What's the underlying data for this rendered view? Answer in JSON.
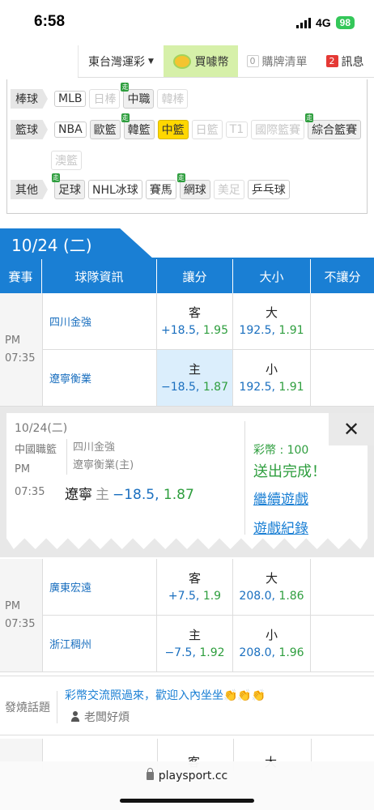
{
  "status_bar": {
    "time": "6:58",
    "network": "4G",
    "battery": "98"
  },
  "top_nav": {
    "lottery_label": "東台灣運彩",
    "buy_label": "買噱幣",
    "cart_count": "0",
    "cart_label": "購牌清單",
    "message_count": "2",
    "message_label": "訊息"
  },
  "filters": {
    "baseball": {
      "label": "棒球",
      "items": [
        {
          "label": "MLB",
          "state": "normal",
          "tag": ""
        },
        {
          "label": "日棒",
          "state": "off",
          "tag": ""
        },
        {
          "label": "中職",
          "state": "walk",
          "tag": "走"
        },
        {
          "label": "韓棒",
          "state": "off",
          "tag": ""
        }
      ]
    },
    "basketball": {
      "label": "籃球",
      "items": [
        {
          "label": "NBA",
          "state": "normal",
          "tag": ""
        },
        {
          "label": "歐籃",
          "state": "walk",
          "tag": ""
        },
        {
          "label": "韓籃",
          "state": "walk",
          "tag": "走"
        },
        {
          "label": "中籃",
          "state": "sel",
          "tag": ""
        },
        {
          "label": "日籃",
          "state": "off",
          "tag": ""
        },
        {
          "label": "T1",
          "state": "off",
          "tag": ""
        },
        {
          "label": "國際籃賽",
          "state": "off",
          "tag": ""
        },
        {
          "label": "綜合籃賽",
          "state": "walk",
          "tag": "走"
        },
        {
          "label": "澳籃",
          "state": "off",
          "tag": ""
        }
      ]
    },
    "other": {
      "label": "其他",
      "items": [
        {
          "label": "足球",
          "state": "walk",
          "tag": "走"
        },
        {
          "label": "NHL冰球",
          "state": "normal",
          "tag": ""
        },
        {
          "label": "賽馬",
          "state": "normal",
          "tag": ""
        },
        {
          "label": "網球",
          "state": "walk",
          "tag": "走"
        },
        {
          "label": "美足",
          "state": "off",
          "tag": ""
        },
        {
          "label": "乒乓球",
          "state": "normal",
          "tag": ""
        }
      ]
    }
  },
  "date_tab": "10/24 (二)",
  "table_header": {
    "event": "賽事",
    "team_info": "球隊資訊",
    "spread": "讓分",
    "total": "大小",
    "moneyline": "不讓分"
  },
  "games": [
    {
      "ampm": "PM",
      "time": "07:35",
      "away": {
        "team": "四川金強",
        "spread_key": "客",
        "spread_line": "+18.5",
        "spread_odds": "1.95",
        "total_key": "大",
        "total_line": "192.5",
        "total_odds": "1.91"
      },
      "home": {
        "team": "遼寧衡業",
        "spread_key": "主",
        "spread_line": "−18.5",
        "spread_odds": "1.87",
        "total_key": "小",
        "total_line": "192.5",
        "total_odds": "1.91"
      }
    },
    {
      "ampm": "PM",
      "time": "07:35",
      "away": {
        "team": "廣東宏遠",
        "spread_key": "客",
        "spread_line": "+7.5",
        "spread_odds": "1.9",
        "total_key": "大",
        "total_line": "208.0",
        "total_odds": "1.86"
      },
      "home": {
        "team": "浙江稠州",
        "spread_key": "主",
        "spread_line": "−7.5",
        "spread_odds": "1.92",
        "total_key": "小",
        "total_line": "208.0",
        "total_odds": "1.96"
      }
    }
  ],
  "popup": {
    "date": "10/24(二)",
    "league": "中國職籃",
    "ampm": "PM",
    "time": "07:35",
    "team_away": "四川金強",
    "team_home": "遼寧衡業(主)",
    "pick_team": "遼寧",
    "pick_side": "主",
    "pick_line": "−18.5,",
    "pick_odds": "1.87",
    "coins": "彩幣 : 100",
    "status": "送出完成！",
    "continue_link": "繼續遊戲",
    "history_link": "遊戲紀錄",
    "close": "✕"
  },
  "chat": {
    "label": "發燒話題",
    "message": "彩幣交流照過來，歡迎入內坐坐👏👏👏",
    "user": "老闆好煩"
  },
  "partial_row": {
    "away_key": "客",
    "total_key": "大"
  },
  "browser": {
    "url": "playsport.cc"
  }
}
